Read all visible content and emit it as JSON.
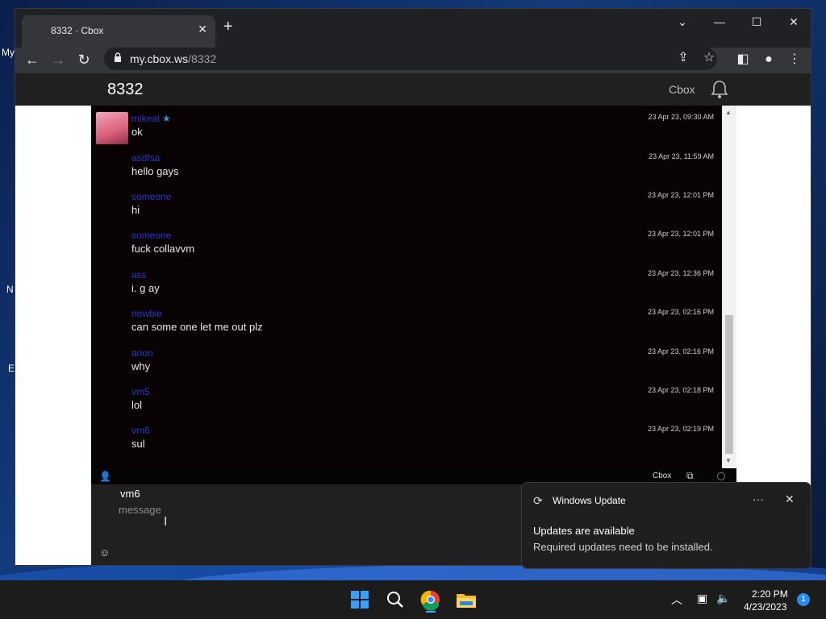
{
  "desktop": {
    "label_my": "My",
    "label_n": "N",
    "label_e": "E"
  },
  "browser": {
    "tab_title": "8332 · Cbox",
    "new_tab": "+",
    "url_host": "my.cbox.ws",
    "url_path": "/8332"
  },
  "cbox": {
    "title": "8332",
    "brand": "Cbox",
    "footer_brand": "Cbox",
    "messages": [
      {
        "user": "mikeal",
        "starred": true,
        "text": "ok",
        "time": "23 Apr 23, 09:30 AM",
        "has_avatar": true
      },
      {
        "user": "asdfsa",
        "text": "hello gays",
        "time": "23 Apr 23, 11:59 AM"
      },
      {
        "user": "someone",
        "text": "hi",
        "time": "23 Apr 23, 12:01 PM"
      },
      {
        "user": "someone",
        "text": "fuck collavvm",
        "time": "23 Apr 23, 12:01 PM"
      },
      {
        "user": "ass",
        "text": "i. g ay",
        "time": "23 Apr 23, 12:36 PM"
      },
      {
        "user": "newbie",
        "text": "can some one let me out plz",
        "time": "23 Apr 23, 02:16 PM"
      },
      {
        "user": "anon",
        "text": "why",
        "time": "23 Apr 23, 02:16 PM"
      },
      {
        "user": "vm5",
        "text": "lol",
        "time": "23 Apr 23, 02:18 PM"
      },
      {
        "user": "vm6",
        "text": "sul",
        "time": "23 Apr 23, 02:19 PM"
      }
    ],
    "compose": {
      "name": "vm6",
      "placeholder": "message",
      "value": ""
    }
  },
  "notification": {
    "app": "Windows Update",
    "headline": "Updates are available",
    "body": "Required updates need to be installed."
  },
  "taskbar": {
    "time": "2:20 PM",
    "date": "4/23/2023",
    "badge": "1"
  },
  "colors": {
    "username": "#2a39c8",
    "chat_bg": "#090204",
    "accent": "#2b8be8"
  }
}
